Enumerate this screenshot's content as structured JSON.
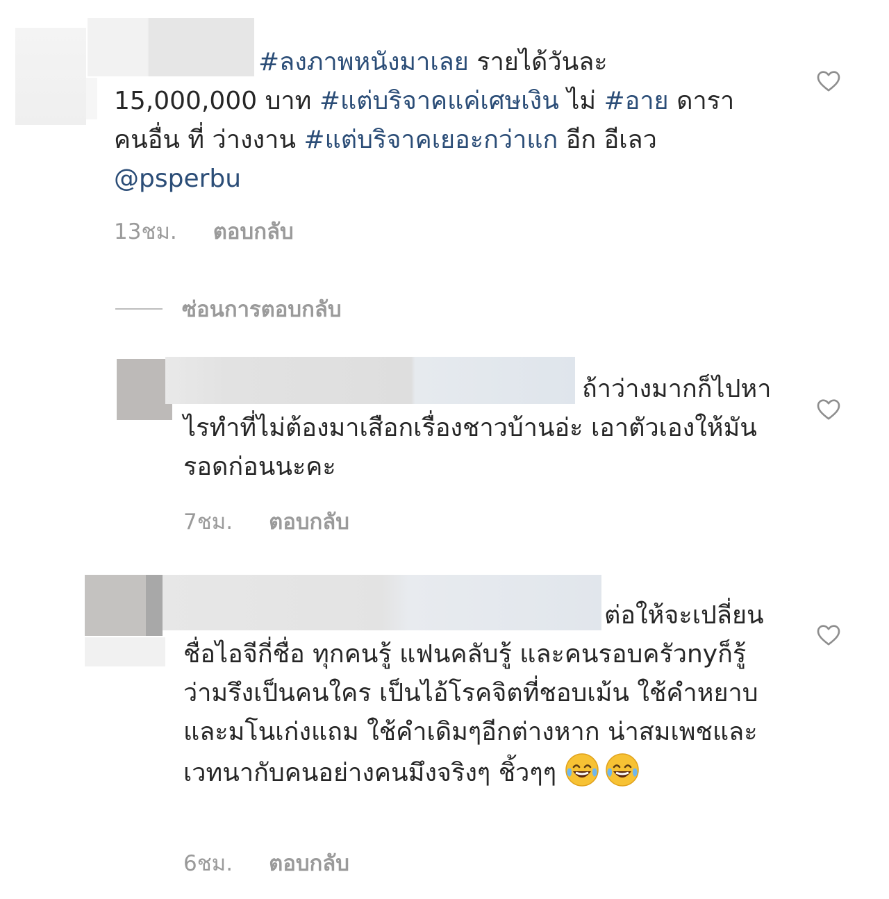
{
  "comments": [
    {
      "segments": [
        {
          "text": "#ลงภาพหนังมาเลย",
          "type": "hashtag"
        },
        {
          "text": " รายได้วันละ 15,000,000 บาท ",
          "type": "text"
        },
        {
          "text": "#แต่บริจาคแค่เศษเงิน",
          "type": "hashtag"
        },
        {
          "text": " ไม่ ",
          "type": "text"
        },
        {
          "text": "#อาย",
          "type": "hashtag"
        },
        {
          "text": " ดาราคนอื่น ที่ ว่างงาน ",
          "type": "text"
        },
        {
          "text": "#แต่บริจาคเยอะกว่าแก",
          "type": "hashtag"
        },
        {
          "text": " อีก อีเลว ",
          "type": "text"
        },
        {
          "text": "@psperbu",
          "type": "mention"
        }
      ],
      "time": "13ชม.",
      "reply_label": "ตอบกลับ"
    },
    {
      "text": "ถ้าว่างมากก็ไปหาไรทำที่ไม่ต้องมาเสือกเรื่องชาวบ้านอ่ะ เอาตัวเองให้มันรอดก่อนนะคะ",
      "time": "7ชม.",
      "reply_label": "ตอบกลับ"
    },
    {
      "text": "ต่อให้จะเปลี่ยนชื่อไอจีกี่ชื่อ ทุกคนรู้ แฟนคลับรู้ และคนรอบครัวnyก็รู้ว่ามรึงเป็นคนใคร เป็นไอ้โรคจิตที่ชอบเม้น ใช้คำหยาบและมโนเก่งแถม ใช้คำเดิมๆอีกต่างหาก น่าสมเพชและเวทนากับคนอย่างคนมึงจริงๆ ชิ้วๆๆ",
      "emoji": [
        "tears-of-joy",
        "tears-of-joy"
      ],
      "time": "6ชม.",
      "reply_label": "ตอบกลับ"
    }
  ],
  "hide_replies_label": "ซ่อนการตอบกลับ",
  "colors": {
    "hashtag": "#2b4d77",
    "meta": "#9a9a9a",
    "text": "#262626"
  },
  "icons": {
    "like": "heart-outline-icon"
  }
}
